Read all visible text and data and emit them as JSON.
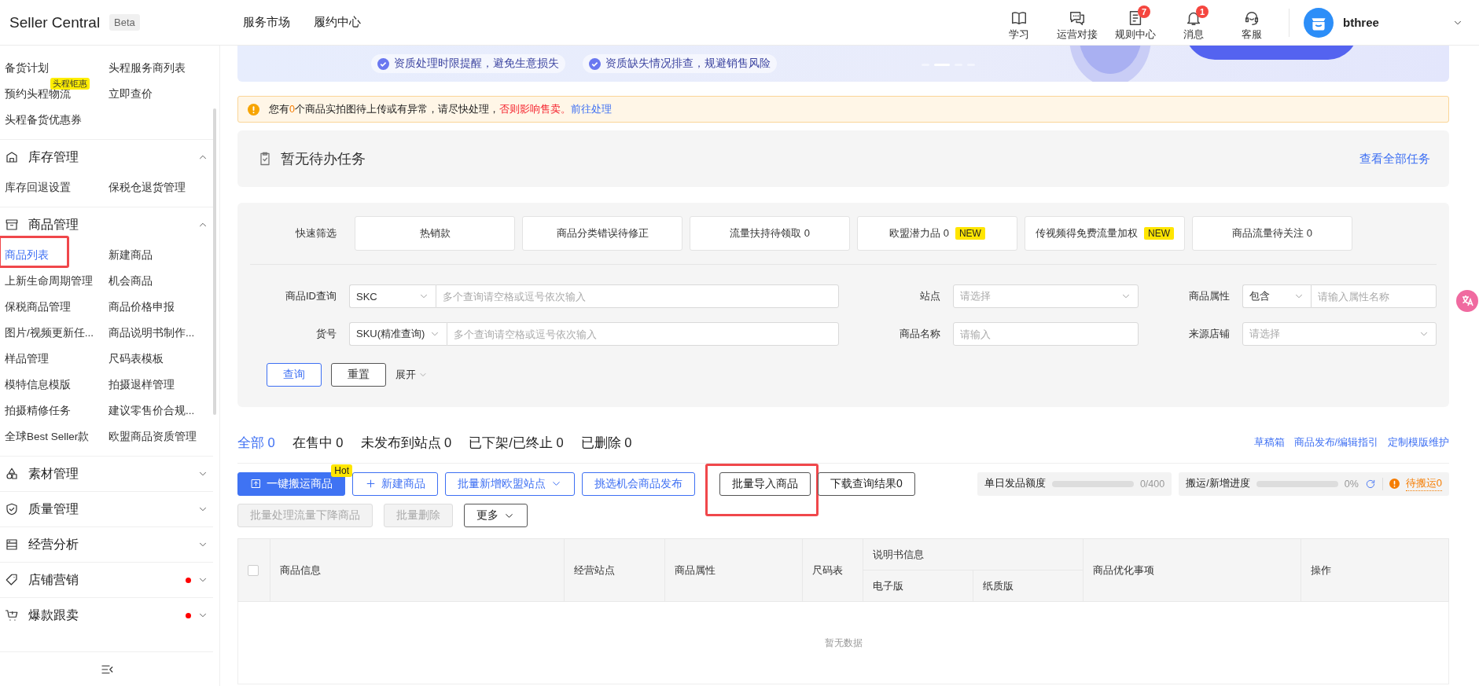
{
  "header": {
    "logo": "Seller Central",
    "badge": "Beta",
    "nav": [
      {
        "label": "服务市场"
      },
      {
        "label": "履约中心"
      }
    ],
    "tools": [
      {
        "label": "学习"
      },
      {
        "label": "运营对接"
      },
      {
        "label": "规则中心",
        "badge": "7"
      },
      {
        "label": "消息",
        "badge": "1"
      },
      {
        "label": "客服"
      }
    ],
    "user": {
      "name": "bthree"
    }
  },
  "sidebar": {
    "top_items": [
      {
        "label": "备货计划",
        "selected": false
      },
      {
        "label": "头程服务商列表",
        "selected": false
      },
      {
        "label": "预约头程物流",
        "badge": "头程钜惠",
        "selected": false
      },
      {
        "label": "立即查价",
        "selected": false
      },
      {
        "label": "头程备货优惠券",
        "selected": false
      }
    ],
    "sections": [
      {
        "title": "库存管理",
        "expanded": true,
        "dot": false,
        "items": [
          {
            "label": "库存回退设置",
            "selected": false
          },
          {
            "label": "保税仓退货管理",
            "selected": false
          }
        ]
      },
      {
        "title": "商品管理",
        "expanded": true,
        "dot": false,
        "items": [
          {
            "label": "商品列表",
            "selected": true,
            "annotated": true
          },
          {
            "label": "新建商品",
            "selected": false
          },
          {
            "label": "上新生命周期管理",
            "selected": false
          },
          {
            "label": "机会商品",
            "selected": false
          },
          {
            "label": "保税商品管理",
            "selected": false
          },
          {
            "label": "商品价格申报",
            "selected": false
          },
          {
            "label": "图片/视频更新任...",
            "selected": false
          },
          {
            "label": "商品说明书制作...",
            "selected": false
          },
          {
            "label": "样品管理",
            "selected": false
          },
          {
            "label": "尺码表模板",
            "selected": false
          },
          {
            "label": "模特信息模版",
            "selected": false
          },
          {
            "label": "拍摄退样管理",
            "selected": false
          },
          {
            "label": "拍摄精修任务",
            "selected": false
          },
          {
            "label": "建议零售价合规...",
            "selected": false
          },
          {
            "label": "全球Best Seller款",
            "selected": false
          },
          {
            "label": "欧盟商品资质管理",
            "selected": false
          }
        ]
      },
      {
        "title": "素材管理",
        "expanded": false,
        "dot": false
      },
      {
        "title": "质量管理",
        "expanded": false,
        "dot": false
      },
      {
        "title": "经营分析",
        "expanded": false,
        "dot": false
      },
      {
        "title": "店铺营销",
        "expanded": false,
        "dot": true
      },
      {
        "title": "爆款跟卖",
        "expanded": false,
        "dot": true
      }
    ]
  },
  "banner": {
    "tips": [
      "资质处理时限提醒，避免生意损失",
      "资质缺失情况排查，规避销售风险"
    ],
    "carousel": [
      {
        "selected": false
      },
      {
        "selected": true
      },
      {
        "selected": false
      },
      {
        "selected": false
      }
    ]
  },
  "alert": {
    "parts": [
      {
        "kind": "text",
        "text": "您有"
      },
      {
        "kind": "count",
        "text": "0"
      },
      {
        "kind": "text",
        "text": "个商品实拍图待上传或有异常，请尽快处理，"
      },
      {
        "kind": "warning",
        "text": "否则影响售卖。"
      },
      {
        "kind": "link",
        "text": "前往处理"
      }
    ]
  },
  "todo": {
    "title": "暂无待办任务",
    "link": "查看全部任务"
  },
  "quick_filter": {
    "label": "快速筛选",
    "chips": [
      {
        "label": "热销款",
        "selected": false
      },
      {
        "label": "商品分类错误待修正",
        "selected": false
      },
      {
        "label": "流量扶持待领取",
        "count": "0",
        "selected": false
      },
      {
        "label": "欧盟潜力品",
        "count": "0",
        "tag": "NEW",
        "selected": false
      },
      {
        "label": "传视频得免费流量加权",
        "tag": "NEW",
        "selected": false
      },
      {
        "label": "商品流量待关注",
        "count": "0",
        "selected": false
      }
    ]
  },
  "search_form": {
    "fields": [
      {
        "label": "商品ID查询",
        "kind": "select_input",
        "select": "SKC",
        "placeholder": "多个查询请空格或逗号依次输入"
      },
      {
        "label": "站点",
        "kind": "select",
        "placeholder": "请选择"
      },
      {
        "label": "商品属性",
        "kind": "select_input",
        "select": "包含",
        "placeholder": "请输入属性名称"
      },
      {
        "label": "货号",
        "kind": "select_input",
        "select": "SKU(精准查询)",
        "placeholder": "多个查询请空格或逗号依次输入"
      },
      {
        "label": "商品名称",
        "kind": "input",
        "placeholder": "请输入"
      },
      {
        "label": "来源店铺",
        "kind": "select",
        "placeholder": "请选择"
      }
    ],
    "buttons": [
      {
        "label": "查询",
        "kind": "primary"
      },
      {
        "label": "重置",
        "kind": "default"
      },
      {
        "label": "展开",
        "kind": "toggle"
      }
    ]
  },
  "status_tabs": [
    {
      "label": "全部 0",
      "selected": true
    },
    {
      "label": "在售中 0",
      "selected": false
    },
    {
      "label": "未发布到站点 0",
      "selected": false
    },
    {
      "label": "已下架/已终止 0",
      "selected": false
    },
    {
      "label": "已删除 0",
      "selected": false
    }
  ],
  "links": [
    "草稿箱",
    "商品发布/编辑指引",
    "定制模版维护"
  ],
  "actions": [
    {
      "label": "一键搬运商品",
      "kind": "primary",
      "badge": "Hot",
      "annotated": false
    },
    {
      "label": "新建商品",
      "kind": "add",
      "annotated": false
    },
    {
      "label": "批量新增欧盟站点",
      "kind": "dropdown",
      "annotated": false
    },
    {
      "label": "挑选机会商品发布",
      "kind": "outline",
      "annotated": false
    },
    {
      "label": "批量导入商品",
      "kind": "default",
      "annotated": true
    },
    {
      "label": "下载查询结果0",
      "kind": "default",
      "annotated": false
    }
  ],
  "actions_row2": [
    {
      "label": "批量处理流量下降商品",
      "kind": "default",
      "disabled": true
    },
    {
      "label": "批量删除",
      "kind": "default",
      "disabled": true
    },
    {
      "label": "更多",
      "kind": "more",
      "disabled": false
    }
  ],
  "meters": [
    {
      "label": "单日发品额度",
      "level": 0,
      "reading": "0/400"
    },
    {
      "label": "搬运/新增进度",
      "level": 0,
      "reading": "0%"
    }
  ],
  "pending": "待搬运0",
  "table": {
    "select_all_checked": false,
    "columns": [
      {
        "label": "商品信息"
      },
      {
        "label": "经营站点"
      },
      {
        "label": "商品属性"
      },
      {
        "label": "尺码表"
      },
      {
        "label": "说明书信息",
        "children": [
          {
            "label": "电子版"
          },
          {
            "label": "纸质版"
          }
        ]
      },
      {
        "label": "商品优化事项"
      },
      {
        "label": "操作"
      }
    ],
    "empty_text": "暂无数据"
  }
}
